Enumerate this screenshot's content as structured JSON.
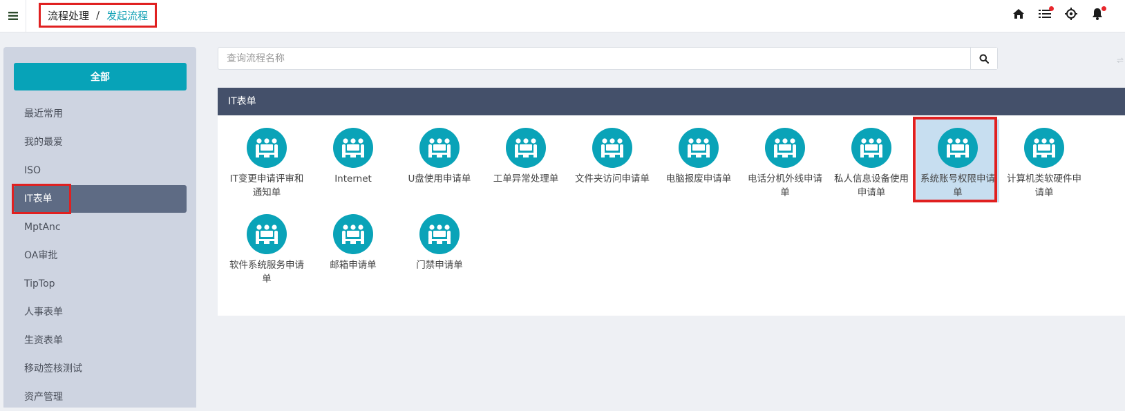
{
  "header": {
    "breadcrumb": [
      "流程处理",
      "发起流程"
    ],
    "separator": "/"
  },
  "sidebar": {
    "all_label": "全部",
    "items": [
      "最近常用",
      "我的最爱",
      "ISO",
      "IT表单",
      "MptAnc",
      "OA审批",
      "TipTop",
      "人事表单",
      "生资表单",
      "移动签核测试",
      "资产管理"
    ],
    "active_index": 3
  },
  "search": {
    "placeholder": "查询流程名称"
  },
  "panel": {
    "title": "IT表单",
    "tiles": [
      "IT变更申请评审和通知单",
      "Internet",
      "U盘使用申请单",
      "工单异常处理单",
      "文件夹访问申请单",
      "电脑报废申请单",
      "电话分机外线申请单",
      "私人信息设备使用申请单",
      "系统账号权限申请单",
      "计算机类软硬件申请单",
      "软件系统服务申请单",
      "邮箱申请单",
      "门禁申请单"
    ],
    "selected_index": 8
  },
  "colors": {
    "accent": "#07a3b8",
    "header_bg": "#44506a",
    "sidebar_bg": "#ced4e1",
    "active_item": "#5e6b84",
    "highlight": "#e02020"
  },
  "icons": [
    "menu-icon",
    "home-icon",
    "list-icon",
    "target-icon",
    "bell-icon",
    "search-icon",
    "meeting-icon"
  ]
}
